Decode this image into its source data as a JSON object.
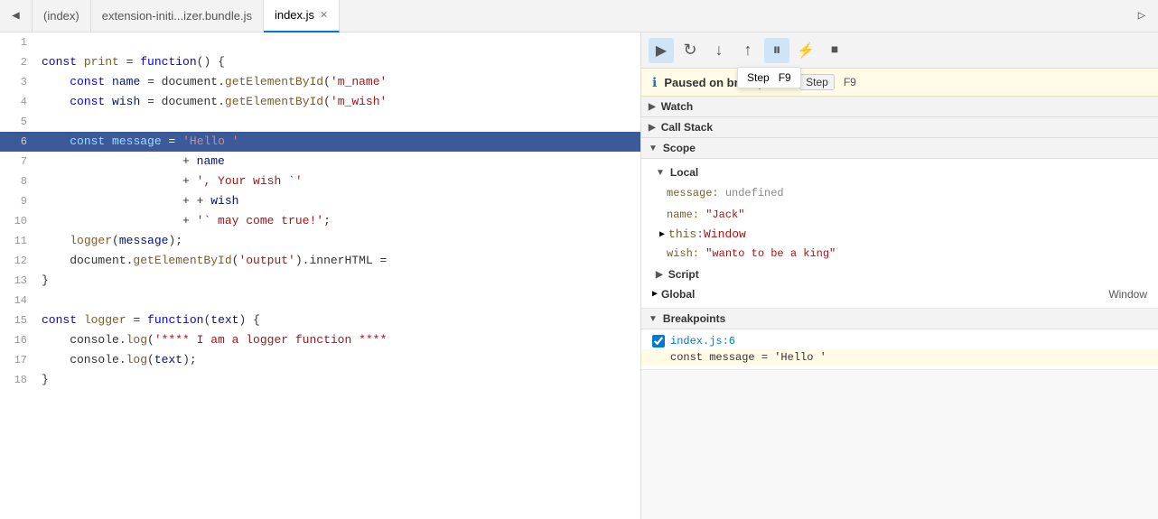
{
  "tabs": [
    {
      "id": "index-tab",
      "label": "(index)",
      "active": false,
      "closable": false
    },
    {
      "id": "ext-tab",
      "label": "extension-initi...izer.bundle.js",
      "active": false,
      "closable": false
    },
    {
      "id": "indexjs-tab",
      "label": "index.js",
      "active": true,
      "closable": true
    }
  ],
  "sidebar_toggle_icon": "◀",
  "run_icon": "▶",
  "code": {
    "lines": [
      {
        "num": 1,
        "content": "",
        "highlighted": false
      },
      {
        "num": 2,
        "content": "const print = function() {",
        "highlighted": false
      },
      {
        "num": 3,
        "content": "    const name = document.getElementById('m_name'",
        "highlighted": false
      },
      {
        "num": 4,
        "content": "    const wish = document.getElementById('m_wish'",
        "highlighted": false
      },
      {
        "num": 5,
        "content": "",
        "highlighted": false
      },
      {
        "num": 6,
        "content": "    const message = 'Hello '",
        "highlighted": true
      },
      {
        "num": 7,
        "content": "                    + name",
        "highlighted": false
      },
      {
        "num": 8,
        "content": "                    + ', Your wish `'",
        "highlighted": false
      },
      {
        "num": 9,
        "content": "                    + + wish",
        "highlighted": false
      },
      {
        "num": 10,
        "content": "                    + '` may come true!';",
        "highlighted": false
      },
      {
        "num": 11,
        "content": "    logger(message);",
        "highlighted": false
      },
      {
        "num": 12,
        "content": "    document.getElementById('output').innerHTML =",
        "highlighted": false
      },
      {
        "num": 13,
        "content": "}",
        "highlighted": false
      },
      {
        "num": 14,
        "content": "",
        "highlighted": false
      },
      {
        "num": 15,
        "content": "const logger = function(text) {",
        "highlighted": false
      },
      {
        "num": 16,
        "content": "    console.log('**** I am a logger function ****",
        "highlighted": false
      },
      {
        "num": 17,
        "content": "    console.log(text);",
        "highlighted": false
      },
      {
        "num": 18,
        "content": "}",
        "highlighted": false
      }
    ]
  },
  "debug_toolbar": {
    "buttons": [
      {
        "id": "resume-btn",
        "icon": "▶",
        "label": "Resume",
        "active": true
      },
      {
        "id": "step-over-btn",
        "icon": "↺",
        "label": "Step Over",
        "active": false
      },
      {
        "id": "step-into-btn",
        "icon": "↓",
        "label": "Step Into",
        "active": false
      },
      {
        "id": "step-out-btn",
        "icon": "↑",
        "label": "Step Out",
        "active": false
      },
      {
        "id": "pause-btn",
        "icon": "⏸",
        "label": "Pause",
        "active": true
      },
      {
        "id": "deactivate-btn",
        "icon": "⚡",
        "label": "Deactivate breakpoints",
        "active": false
      },
      {
        "id": "stop-btn",
        "icon": "⏹",
        "label": "Stop",
        "active": false
      }
    ],
    "tooltip": {
      "label": "Step",
      "shortcut": "F9"
    }
  },
  "paused_bar": {
    "icon": "ℹ",
    "text": "Paused on breakpoint",
    "step_label": "Step",
    "shortcut": "F9"
  },
  "sections": {
    "watch": {
      "label": "Watch",
      "expanded": false
    },
    "call_stack": {
      "label": "Call Stack",
      "expanded": false
    },
    "scope": {
      "label": "Scope",
      "expanded": true,
      "subsections": {
        "local": {
          "label": "Local",
          "expanded": true,
          "items": [
            {
              "key": "message:",
              "value": "undefined",
              "type": "undefined"
            },
            {
              "key": "name:",
              "value": "\"Jack\"",
              "type": "string"
            },
            {
              "key": "this:",
              "value": "Window",
              "type": "expandable"
            },
            {
              "key": "wish:",
              "value": "\"wanto to be a king\"",
              "type": "string"
            }
          ]
        },
        "script": {
          "label": "Script",
          "expanded": false
        },
        "global": {
          "label": "Global",
          "expanded": false,
          "value": "Window"
        }
      }
    },
    "breakpoints": {
      "label": "Breakpoints",
      "expanded": true,
      "items": [
        {
          "checked": true,
          "file": "index.js:6",
          "code": "const message = 'Hello '"
        }
      ]
    }
  }
}
